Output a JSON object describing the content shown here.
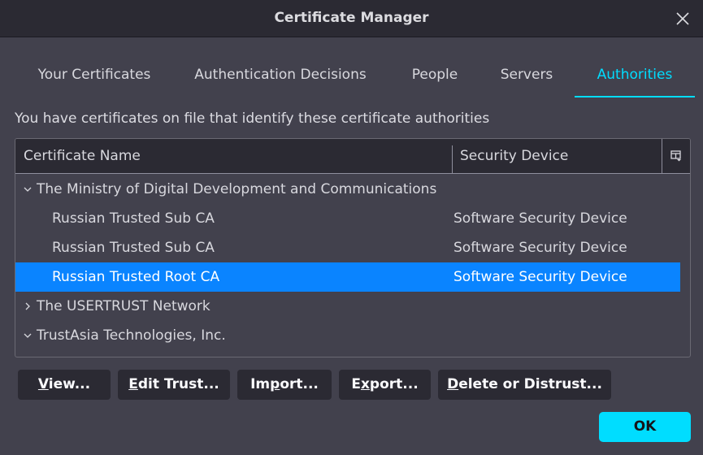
{
  "window": {
    "title": "Certificate Manager"
  },
  "tabs": [
    {
      "label": "Your Certificates"
    },
    {
      "label": "Authentication Decisions"
    },
    {
      "label": "People"
    },
    {
      "label": "Servers"
    },
    {
      "label": "Authorities",
      "active": true
    }
  ],
  "description": "You have certificates on file that identify these certificate authorities",
  "table": {
    "columns": [
      "Certificate Name",
      "Security Device"
    ],
    "groups": [
      {
        "name": "The Ministry of Digital Development and Communications",
        "expanded": true,
        "certs": [
          {
            "name": "Russian Trusted Sub CA",
            "device": "Software Security Device"
          },
          {
            "name": "Russian Trusted Sub CA",
            "device": "Software Security Device"
          },
          {
            "name": "Russian Trusted Root CA",
            "device": "Software Security Device",
            "selected": true
          }
        ]
      },
      {
        "name": "The USERTRUST Network",
        "expanded": false
      },
      {
        "name": "TrustAsia Technologies, Inc.",
        "expanded": true
      }
    ]
  },
  "buttons": {
    "view": {
      "pre": "",
      "key": "V",
      "post": "iew..."
    },
    "edit_trust": {
      "pre": "",
      "key": "E",
      "post": "dit Trust..."
    },
    "import": {
      "pre": "Im",
      "key": "p",
      "post": "ort..."
    },
    "export": {
      "pre": "E",
      "key": "x",
      "post": "port..."
    },
    "delete": {
      "pre": "",
      "key": "D",
      "post": "elete or Distrust..."
    },
    "ok": "OK"
  },
  "colors": {
    "accent": "#00ddff",
    "selection": "#0a84ff",
    "background": "#42414d",
    "titlebar": "#2b2a33"
  },
  "icons": [
    "close-icon",
    "column-picker-icon",
    "chevron-down-icon",
    "chevron-right-icon"
  ]
}
